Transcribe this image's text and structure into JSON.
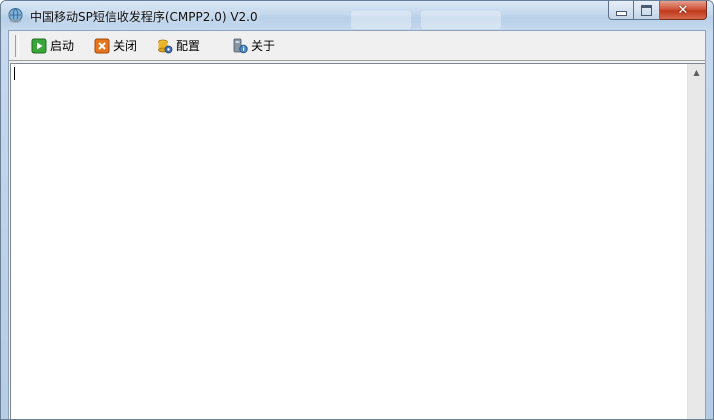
{
  "window": {
    "title": "中国移动SP短信收发程序(CMPP2.0) V2.0",
    "app_icon": "globe-app-icon"
  },
  "caption_buttons": {
    "minimize_icon": "minimize-icon",
    "maximize_icon": "maximize-icon",
    "close_glyph": "✕"
  },
  "toolbar": {
    "items": [
      {
        "label": "启动",
        "icon": "play-icon",
        "color": "#2e9c2e"
      },
      {
        "label": "关闭",
        "icon": "stop-icon",
        "color": "#e06a1a"
      },
      {
        "label": "配置",
        "icon": "config-icon",
        "color": "#d8a21a"
      },
      {
        "label": "关于",
        "icon": "about-icon",
        "color": "#6a7888"
      }
    ]
  },
  "log_area": {
    "value": ""
  },
  "colors": {
    "frame": "#c9dcef",
    "close_button": "#c0391d",
    "client_bg": "#f0f0f0",
    "text_bg": "#ffffff"
  }
}
